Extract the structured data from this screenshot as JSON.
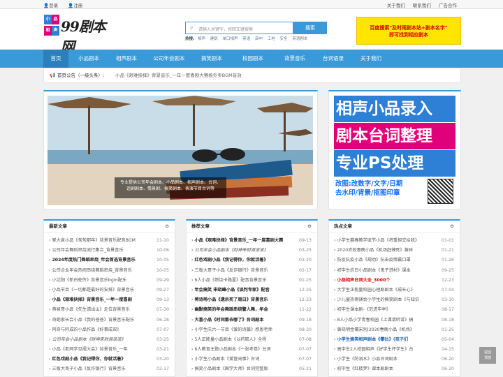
{
  "topbar": {
    "login": "登录",
    "register": "注册",
    "about": "关于我们",
    "contact": "联系我们",
    "ads": "广告合作"
  },
  "logo": {
    "text": "99剧本网",
    "box_chars": [
      "小",
      "品",
      "相",
      "声"
    ]
  },
  "search": {
    "placeholder": "请输入关键字，按回车键搜索",
    "button": "搜索"
  },
  "hot": {
    "label": "热搜:",
    "terms": [
      "相声",
      "建筑",
      "单口相声",
      "英语",
      "高中",
      "工地",
      "安全",
      "英语剧本"
    ]
  },
  "ad": {
    "line1": "百度搜索\"及时雨剧本站+剧本名字\"",
    "line2": "即可找到相应剧本"
  },
  "nav": {
    "items": [
      "首页",
      "小品剧本",
      "相声剧本",
      "公司年会剧本",
      "搞笑剧本",
      "校园剧本",
      "背景音乐",
      "台词语录",
      "关于我们"
    ]
  },
  "notice": {
    "label": "首页公告（一级头条）:",
    "text": "小品《艰难抉择》背景音乐_一年一度喜剧大赛杨外卖BGM音效"
  },
  "slider": {
    "caption": "专业提供公司年会剧本、小品剧本、相声剧本、台词、话剧剧本、情景剧、搞笑剧本、表演节目台词等"
  },
  "right_ad": {
    "line1": "相声小品录入",
    "line2": "剧本台词整理",
    "line3": "专业PS处理",
    "line4": "改图:改数字/文字/日期",
    "line5": "去水印/背景/抠图印章"
  },
  "lists": [
    {
      "title": "最新文章",
      "items": [
        {
          "t": "崔大泉小品《匆匆那年》背景音乐配音BGM",
          "d": "11-10",
          "s": ""
        },
        {
          "t": "公司年会舞蹈串烧流行集合_背景音乐",
          "d": "10-06",
          "s": ""
        },
        {
          "t": "2024年度热门舞蹈串烧_年会首选背景音乐",
          "d": "10-05",
          "s": "bold"
        },
        {
          "t": "公司企业年会热闹串烧舞蹈串烧_背景音乐",
          "d": "10-05",
          "s": ""
        },
        {
          "t": "小沈阳《新白蛇传》背景音乐bgm配乐",
          "d": "09-29",
          "s": ""
        },
        {
          "t": "小品节目《一切都是最好的安排》背景音乐",
          "d": "09-27",
          "s": ""
        },
        {
          "t": "小品《艰难抉择》背景音乐_一年一度喜剧",
          "d": "09-13",
          "s": "bold"
        },
        {
          "t": "蒋易哥小品《先生请出山》走位背景音乐",
          "d": "07-30",
          "s": ""
        },
        {
          "t": "奇葩家长会小品《我的爸爸》背景音乐配乐",
          "d": "06-28",
          "s": ""
        },
        {
          "t": "阿奇与阿成的小品作品《好事成双》",
          "d": "07-07",
          "s": ""
        },
        {
          "t": "公司年会小品剧本《财神来财源滚滚》",
          "d": "03-25",
          "s": "ital"
        },
        {
          "t": "小品《老同学见摆大会》背景音乐_一年",
          "d": "03-21",
          "s": ""
        },
        {
          "t": "红色戏剧小品《我记得你，你就活着》",
          "d": "03-20",
          "s": "bold"
        },
        {
          "t": "三板大哥子小品《反诈银行》背景音乐",
          "d": "02-17",
          "s": ""
        },
        {
          "t": "小品剧本《赞美你》全文完整版",
          "d": "02-10",
          "s": ""
        }
      ]
    },
    {
      "title": "推荐文章",
      "items": [
        {
          "t": "小品《艰难抉择》背景音乐_一年一度喜剧大赛",
          "d": "09-13",
          "s": "bold"
        },
        {
          "t": "公司年会小品剧本《财神来财源滚滚》",
          "d": "03-25",
          "s": "ital"
        },
        {
          "t": "红色戏剧小品《我记得你，你就活着》",
          "d": "03-20",
          "s": "bold"
        },
        {
          "t": "三板大哥子小品《反诈银行》背景音乐",
          "d": "02-17",
          "s": ""
        },
        {
          "t": "6人小品《燃烧卡路里》配音背景音乐",
          "d": "01-25",
          "s": ""
        },
        {
          "t": "年会搞笑 宋晓峰小品《谈判专家》配音",
          "d": "12-25",
          "s": "bold"
        },
        {
          "t": "蒋诗萌小品《遗杀死了周日》背景音乐",
          "d": "12-23",
          "s": "bold"
        },
        {
          "t": "幽默搞笑的年会舞蹈串烧警人舞，年会",
          "d": "11-22",
          "s": "bold"
        },
        {
          "t": "大喜小品《时间都去哪了》台词剧本",
          "d": "09-18",
          "s": "bold"
        },
        {
          "t": "小学生庆六一节目《爱的诗篇》感恩老师",
          "d": "08-20",
          "s": ""
        },
        {
          "t": "5人正能量小品剧本《以药取人》全程",
          "d": "07-08",
          "s": ""
        },
        {
          "t": "6人教育主题小品剧本《一张考卷》台词",
          "d": "07-07",
          "s": ""
        },
        {
          "t": "小学生小品剧本《爱管闲事》台词",
          "d": "07-07",
          "s": ""
        },
        {
          "t": "搞笑小品剧本《国学大师》台词完整版",
          "d": "05-21",
          "s": ""
        },
        {
          "t": "搞笑小品剧本《新白娘子传奇》台词完整",
          "d": "05-21",
          "s": ""
        }
      ]
    },
    {
      "title": "热点文章",
      "items": [
        {
          "t": "小学生暮春教学诞节小品《将重担交给我》",
          "d": "01-01",
          "s": ""
        },
        {
          "t": "2020农校春晚小品《机场赶辣死》黄碎",
          "d": "01-21",
          "s": ""
        },
        {
          "t": "防疫抗疫小品《规劝》抗击疫情戴口罩",
          "d": "01-26",
          "s": ""
        },
        {
          "t": "初中生抗日小品剧本《鬼子进村》课本",
          "d": "09-25",
          "s": ""
        },
        {
          "t": "小品相声台词大全_3000个",
          "d": "12-23",
          "s": "red"
        },
        {
          "t": "大学生正能量校园心理剧剧本《成长心》",
          "d": "07-04",
          "s": ""
        },
        {
          "t": "少儿童热雨诵会小学生的搞笑剧本《与知识",
          "d": "03-10",
          "s": ""
        },
        {
          "t": "初中生课本剧-《范进中举》",
          "d": "08-17",
          "s": ""
        },
        {
          "t": "8人小品小学青春校园《上课请听讲》搞",
          "d": "08-18",
          "s": ""
        },
        {
          "t": "黄晓明金镶宋别|2020春晚小品《机场》",
          "d": "01-25",
          "s": ""
        },
        {
          "t": "小学生搞笑相声剧本《攀比》(孩子们",
          "d": "05-04",
          "s": "blue"
        },
        {
          "t": "高中生2人校园相声《好学生坏学生》台",
          "d": "04-15",
          "s": ""
        },
        {
          "t": "小学生《防溺水》小品台词剧本",
          "d": "06-20",
          "s": ""
        },
        {
          "t": "初中生《红楼梦》课本剧剧本",
          "d": "06-20",
          "s": ""
        },
        {
          "t": "有趣的庆六一小品剧本《我们的节日》",
          "d": "05-28",
          "s": ""
        }
      ]
    }
  ],
  "backtop": {
    "line1": "返回",
    "line2": "顶部"
  },
  "colors": {
    "primary": "#3a9ad9",
    "nav_active": "#2b7fbb",
    "ad_yellow": "#ffe500",
    "ad_red": "#d40000",
    "pink": "#e0007a"
  }
}
